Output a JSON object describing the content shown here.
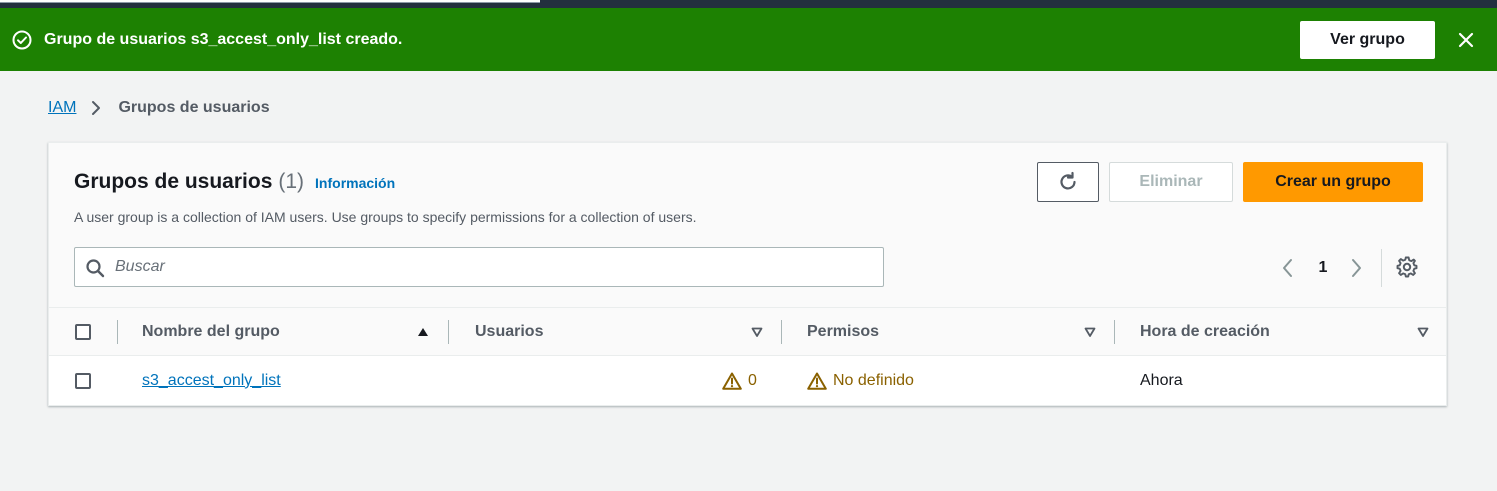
{
  "flash": {
    "message": "Grupo de usuarios s3_accest_only_list creado.",
    "view_button": "Ver grupo",
    "color": "#1d8102"
  },
  "breadcrumb": {
    "root": "IAM",
    "current": "Grupos de usuarios"
  },
  "panel": {
    "title": "Grupos de usuarios",
    "count": "(1)",
    "info_link": "Información",
    "description": "A user group is a collection of IAM users. Use groups to specify permissions for a collection of users.",
    "buttons": {
      "refresh_icon": "refresh-icon",
      "delete": "Eliminar",
      "create": "Crear un grupo"
    },
    "search": {
      "placeholder": "Buscar",
      "value": ""
    },
    "pagination": {
      "current_page": "1"
    },
    "accent_color": "#ff9900",
    "link_color": "#0073bb"
  },
  "table": {
    "columns": [
      "Nombre del grupo",
      "Usuarios",
      "Permisos",
      "Hora de creación"
    ],
    "sorted_column": "Nombre del grupo",
    "sort_direction": "ascending",
    "rows": [
      {
        "name": "s3_accest_only_list",
        "users": "0",
        "permissions": "No definido",
        "created": "Ahora"
      }
    ]
  }
}
